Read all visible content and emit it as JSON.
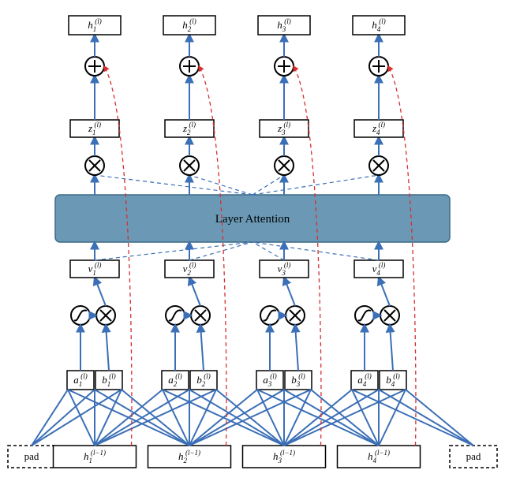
{
  "diagram": {
    "attention_label": "Layer Attention",
    "pad_label": "pad",
    "columns": [
      {
        "h_top": {
          "base": "h",
          "sub": "1",
          "sup": "(l)"
        },
        "z": {
          "base": "z",
          "sub": "1",
          "sup": "(l)"
        },
        "v": {
          "base": "v",
          "sub": "1",
          "sup": "(l)"
        },
        "a": {
          "base": "a",
          "sub": "1",
          "sup": "(l)"
        },
        "b": {
          "base": "b",
          "sub": "1",
          "sup": "(l)"
        },
        "h_prev": {
          "base": "h",
          "sub": "1",
          "sup": "(l−1)"
        }
      },
      {
        "h_top": {
          "base": "h",
          "sub": "2",
          "sup": "(l)"
        },
        "z": {
          "base": "z",
          "sub": "2",
          "sup": "(l)"
        },
        "v": {
          "base": "v",
          "sub": "2",
          "sup": "(l)"
        },
        "a": {
          "base": "a",
          "sub": "2",
          "sup": "(l)"
        },
        "b": {
          "base": "b",
          "sub": "2",
          "sup": "(l)"
        },
        "h_prev": {
          "base": "h",
          "sub": "2",
          "sup": "(l−1)"
        }
      },
      {
        "h_top": {
          "base": "h",
          "sub": "3",
          "sup": "(l)"
        },
        "z": {
          "base": "z",
          "sub": "3",
          "sup": "(l)"
        },
        "v": {
          "base": "v",
          "sub": "3",
          "sup": "(l)"
        },
        "a": {
          "base": "a",
          "sub": "3",
          "sup": "(l)"
        },
        "b": {
          "base": "b",
          "sub": "3",
          "sup": "(l)"
        },
        "h_prev": {
          "base": "h",
          "sub": "3",
          "sup": "(l−1)"
        }
      },
      {
        "h_top": {
          "base": "h",
          "sub": "4",
          "sup": "(l)"
        },
        "z": {
          "base": "z",
          "sub": "4",
          "sup": "(l)"
        },
        "v": {
          "base": "v",
          "sub": "4",
          "sup": "(l)"
        },
        "a": {
          "base": "a",
          "sub": "4",
          "sup": "(l)"
        },
        "b": {
          "base": "b",
          "sub": "4",
          "sup": "(l)"
        },
        "h_prev": {
          "base": "h",
          "sub": "4",
          "sup": "(l−1)"
        }
      }
    ],
    "operators": {
      "plus": "add-op",
      "times": "mul-op",
      "sigma": "sigmoid-op"
    },
    "colors": {
      "blue_line": "#3b6fb6",
      "red_line": "#d62f2f",
      "attn_fill": "#6b99b5"
    }
  }
}
